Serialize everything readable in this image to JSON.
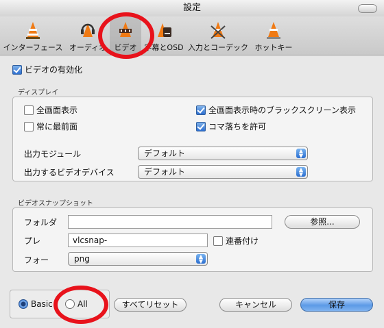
{
  "window": {
    "title": "設定"
  },
  "toolbar": {
    "tabs": [
      {
        "label": "インターフェース"
      },
      {
        "label": "オーディオ"
      },
      {
        "label": "ビデオ"
      },
      {
        "label": "字幕とOSD"
      },
      {
        "label": "入力とコーデック"
      },
      {
        "label": "ホットキー"
      }
    ]
  },
  "video": {
    "enable_label": "ビデオの有効化",
    "enable_checked": true,
    "display": {
      "title": "ディスプレイ",
      "fullscreen_label": "全画面表示",
      "fullscreen_checked": false,
      "fullscreen_black_label": "全画面表示時のブラックスクリーン表示",
      "fullscreen_black_checked": true,
      "always_on_top_label": "常に最前面",
      "always_on_top_checked": false,
      "allow_frame_drop_label": "コマ落ちを許可",
      "allow_frame_drop_checked": true,
      "output_module_label": "出力モジュール",
      "output_module_value": "デフォルト",
      "output_device_label": "出力するビデオデバイス",
      "output_device_value": "デフォルト"
    },
    "snapshot": {
      "title": "ビデオスナップショット",
      "folder_label": "フォルダ",
      "folder_value": "",
      "browse_button": "参照...",
      "prefix_label": "プレ",
      "prefix_value": "vlcsnap-",
      "sequential_label": "連番付け",
      "sequential_checked": false,
      "format_label": "フォー",
      "format_value": "png"
    }
  },
  "footer": {
    "basic_label": "Basic",
    "all_label": "All",
    "selected": "Basic",
    "reset_button": "すべてリセット",
    "cancel_button": "キャンセル",
    "save_button": "保存"
  },
  "colors": {
    "annotation_red": "#e8121b",
    "accent_blue": "#2c6fd0"
  }
}
